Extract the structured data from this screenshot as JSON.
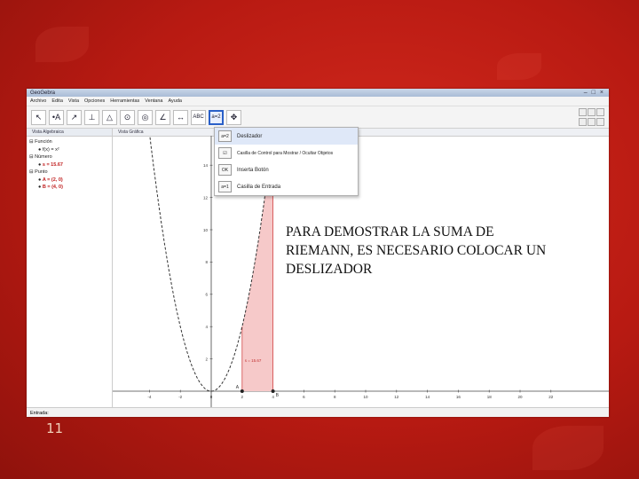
{
  "slide": {
    "number": "11"
  },
  "window": {
    "title": "GeoGebra",
    "controls": [
      "–",
      "□",
      "×"
    ]
  },
  "menu": [
    "Archivo",
    "Edita",
    "Vista",
    "Opciones",
    "Herramientas",
    "Ventana",
    "Ayuda"
  ],
  "toolbar": {
    "tools": [
      "↖",
      "•A",
      "↗",
      "⊥",
      "△",
      "⊙",
      "◎",
      "∠",
      "↔",
      "ABC",
      "a=2",
      "✥"
    ],
    "selected_index": 10
  },
  "algebra": {
    "header": "Vista Algebraica",
    "groups": [
      {
        "name": "Función",
        "items": [
          "f(x) = x²"
        ]
      },
      {
        "name": "Número",
        "items": [
          "s = 15.67"
        ]
      },
      {
        "name": "Punto",
        "items": [
          "A = (2, 0)",
          "B = (4, 0)"
        ]
      }
    ]
  },
  "graphics": {
    "header": "Vista Gráfica",
    "x_ticks": [
      "-4",
      "-2",
      "0",
      "2",
      "4",
      "6",
      "8",
      "10",
      "12",
      "14",
      "16",
      "18",
      "20",
      "22"
    ],
    "y_ticks": [
      "2",
      "4",
      "6",
      "8",
      "10",
      "12",
      "14"
    ],
    "point_labels": [
      "A",
      "B"
    ],
    "area_label": "s = 15.67",
    "colors": {
      "curve": "#333333",
      "area_fill": "#f6c9c9",
      "area_edge": "#d24545"
    }
  },
  "dropdown": {
    "items": [
      {
        "icon": "a=2",
        "label": "Deslizador"
      },
      {
        "icon": "☑",
        "label": "Casilla de Control para Mostrar / Ocultar Objetos"
      },
      {
        "icon": "OK",
        "label": "Inserta Botón"
      },
      {
        "icon": "a=1",
        "label": "Casilla de Entrada"
      }
    ]
  },
  "inputbar": {
    "label": "Entrada:"
  },
  "overlay": {
    "lines": [
      "PARA DEMOSTRAR LA SUMA DE",
      "RIEMANN, ES NECESARIO COLOCAR UN",
      "DESLIZADOR"
    ]
  }
}
